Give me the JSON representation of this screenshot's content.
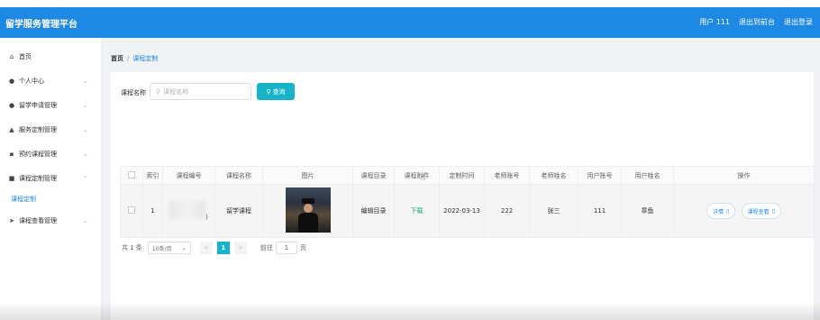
{
  "app": {
    "title": "留学服务管理平台",
    "accent_color": "#1e88e5",
    "button_color": "#17b3c9"
  },
  "header": {
    "user": "用户 111",
    "front_link": "退出到前台",
    "logout": "退出登录"
  },
  "sidebar": {
    "items": [
      {
        "label": "首页",
        "icon": "home-icon",
        "glyph": "⌂"
      },
      {
        "label": "个人中心",
        "icon": "user-icon",
        "glyph": "●",
        "chev": "⌄"
      },
      {
        "label": "留学申请管理",
        "icon": "user-icon",
        "glyph": "●",
        "chev": "⌄"
      },
      {
        "label": "服务定制管理",
        "icon": "thumb-icon",
        "glyph": "▲",
        "chev": "⌄"
      },
      {
        "label": "预约课程管理",
        "icon": "document-icon",
        "glyph": "▪",
        "chev": "⌄"
      },
      {
        "label": "课程定制管理",
        "icon": "folder-icon",
        "glyph": "■",
        "chev": "⌃"
      },
      {
        "label": "课程定制",
        "sub": true
      },
      {
        "label": "课程查看管理",
        "icon": "send-icon",
        "glyph": "➤",
        "chev": "⌄"
      }
    ]
  },
  "breadcrumb": {
    "home": "首页",
    "separator": "/",
    "current": "课程定制"
  },
  "search": {
    "label": "课程名称",
    "placeholder": "课程名称",
    "button": "查询"
  },
  "table": {
    "columns": [
      "",
      "索引",
      "课程编号",
      "课程名称",
      "图片",
      "课程目录",
      "课程附件",
      "定制时间",
      "老师账号",
      "老师姓名",
      "用户账号",
      "用户姓名",
      "操作"
    ],
    "rows": [
      {
        "index": "1",
        "course_no": ")",
        "course_name": "留学课程",
        "image": "graduation-photo",
        "catalog": "编辑目录",
        "attachment": "下载",
        "time": "2022-03-13",
        "teacher_account": "222",
        "teacher_name": "张三",
        "user_account": "111",
        "user_name": "章鱼",
        "actions": {
          "detail": "详情",
          "view": "课程查看"
        }
      }
    ]
  },
  "pagination": {
    "total": "共 1 条",
    "page_size": "10条/页",
    "prev": "<",
    "current_page": "1",
    "next": ">",
    "goto_label": "前往",
    "goto_value": "1",
    "page_unit": "页"
  }
}
